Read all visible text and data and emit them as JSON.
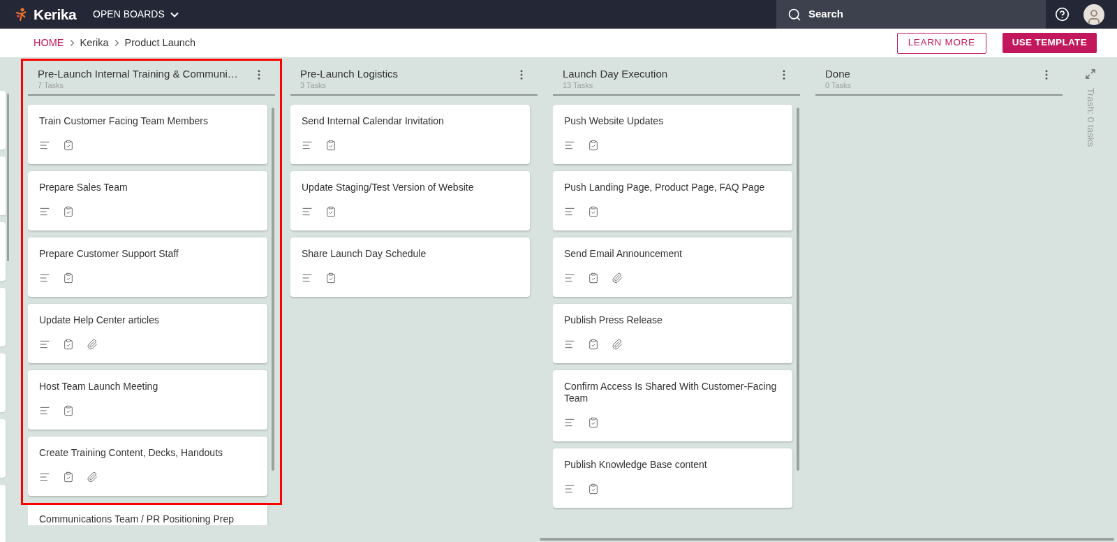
{
  "top_bar": {
    "logo": "Kerika",
    "boards_menu": "OPEN BOARDS",
    "search": {
      "placeholder": "Search"
    }
  },
  "breadcrumb": [
    {
      "label": "HOME",
      "link": true
    },
    {
      "label": "Kerika",
      "link": false
    },
    {
      "label": "Product Launch",
      "link": false
    }
  ],
  "actions": [
    {
      "label": "LEARN MORE",
      "kind": "outline"
    },
    {
      "label": "USE TEMPLATE",
      "kind": "filled"
    }
  ],
  "columns": [
    {
      "title": "Pre-Launch Internal Training & Communi…",
      "count": "7 Tasks",
      "highlighted": true,
      "scrollbar": true,
      "tasks": [
        {
          "title": "Train Customer Facing Team Members",
          "attachment": false
        },
        {
          "title": "Prepare Sales Team",
          "attachment": false
        },
        {
          "title": "Prepare Customer Support Staff",
          "attachment": false
        },
        {
          "title": "Update Help Center articles",
          "attachment": true
        },
        {
          "title": "Host Team Launch Meeting",
          "attachment": false
        },
        {
          "title": "Create Training Content, Decks, Handouts",
          "attachment": true
        },
        {
          "title": "Communications Team / PR Positioning Prep",
          "attachment": false
        }
      ]
    },
    {
      "title": "Pre-Launch Logistics",
      "count": "3 Tasks",
      "highlighted": false,
      "scrollbar": false,
      "tasks": [
        {
          "title": "Send Internal Calendar Invitation",
          "attachment": false
        },
        {
          "title": "Update Staging/Test Version of Website",
          "attachment": false
        },
        {
          "title": "Share Launch Day Schedule",
          "attachment": false
        }
      ]
    },
    {
      "title": "Launch Day Execution",
      "count": "13 Tasks",
      "highlighted": false,
      "scrollbar": true,
      "tasks": [
        {
          "title": "Push Website Updates",
          "attachment": false
        },
        {
          "title": "Push Landing Page, Product Page, FAQ Page",
          "attachment": false
        },
        {
          "title": "Send Email Announcement",
          "attachment": true
        },
        {
          "title": "Publish Press Release",
          "attachment": true
        },
        {
          "title": "Confirm Access Is Shared With Customer-Facing Team",
          "attachment": false
        },
        {
          "title": "Publish Knowledge Base content",
          "attachment": false
        }
      ]
    },
    {
      "title": "Done",
      "count": "0 Tasks",
      "highlighted": false,
      "scrollbar": false
    }
  ],
  "trash": "Trash: 0 tasks"
}
